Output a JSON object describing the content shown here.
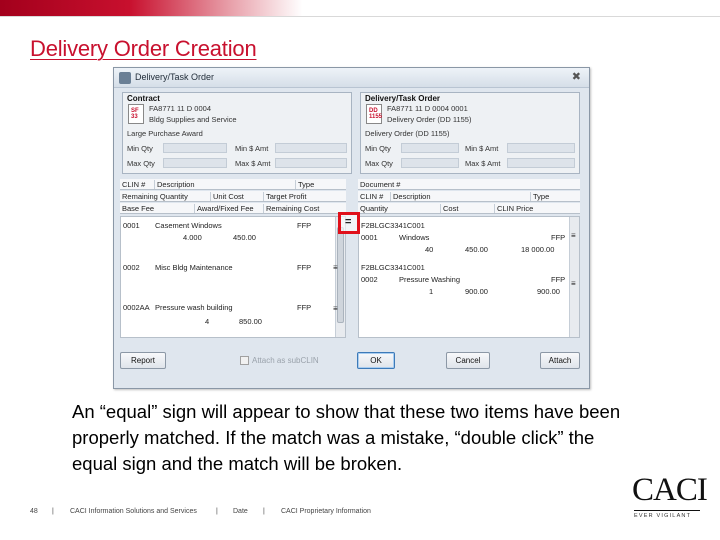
{
  "slide": {
    "title": "Delivery Order Creation",
    "caption": "An “equal” sign will appear to show that these two items have been properly matched.  If the match was a mistake, “double click” the equal sign and the match will be broken."
  },
  "dialog": {
    "title": "Delivery/Task Order",
    "close_glyph": "✖",
    "contract": {
      "title": "Contract",
      "icon_mark": "SF\n33",
      "number": "FA8771 11 D 0004",
      "description": "Bldg Supplies and Service",
      "sub": "Large Purchase Award",
      "min_qty_label": "Min Qty",
      "max_qty_label": "Max Qty",
      "min_amt_label": "Min $ Amt",
      "max_amt_label": "Max $ Amt"
    },
    "delivery": {
      "title": "Delivery/Task Order",
      "icon_mark": "DD\n1155",
      "number": "FA8771 11 D 0004 0001",
      "description": "Delivery Order (DD 1155)",
      "sub": "Delivery Order (DD 1155)",
      "min_qty_label": "Min Qty",
      "max_qty_label": "Max Qty",
      "min_amt_label": "Min $ Amt",
      "max_amt_label": "Max $ Amt"
    },
    "left_headers": {
      "row1": [
        "CLIN #",
        "Description",
        "Type"
      ],
      "row2": [
        "Remaining Quantity",
        "Unit Cost",
        "Target Profit"
      ],
      "row3": [
        "Base Fee",
        "Award/Fixed Fee",
        "Remaining Cost"
      ]
    },
    "right_headers": {
      "row1": [
        "Document #"
      ],
      "row2": [
        "CLIN #",
        "Description",
        "Type"
      ],
      "row3": [
        "Quantity",
        "Cost",
        "CLIN Price"
      ]
    },
    "left_items": [
      {
        "clin": "0001",
        "desc": "Casement Windows",
        "type": "FFP",
        "qty": "4.000",
        "cost": "450.00"
      },
      {
        "clin": "0002",
        "desc": "Misc Bldg Maintenance",
        "type": "FFP",
        "qty": "",
        "cost": ""
      },
      {
        "clin": "0002AA",
        "desc": "Pressure wash building",
        "type": "FFP",
        "qty": "4",
        "cost": "850.00"
      }
    ],
    "right_items": [
      {
        "doc": "F2BLGC3341C001",
        "clin": "0001",
        "desc": "Windows",
        "type": "FFP",
        "qty": "40",
        "cost": "450.00",
        "price": "18 000.00"
      },
      {
        "doc": "F2BLGC3341C001",
        "clin": "0002",
        "desc": "Pressure Washing",
        "type": "FFP",
        "qty": "1",
        "cost": "900.00",
        "price": "900.00"
      }
    ],
    "equal_sign": "=",
    "row_marker": "≡",
    "buttons": {
      "report": "Report",
      "attach_sub": "Attach as subCLIN",
      "ok": "OK",
      "cancel": "Cancel",
      "attach": "Attach"
    }
  },
  "footer": {
    "page_number": "48",
    "separator": "|",
    "company": "CACI Information Solutions and Services",
    "date": "Date",
    "proprietary": "CACI Proprietary Information"
  },
  "logo": {
    "text": "CACI",
    "tagline": "EVER VIGILANT"
  },
  "colors": {
    "brand_red": "#c8102e",
    "highlight_red": "#e0101a"
  }
}
